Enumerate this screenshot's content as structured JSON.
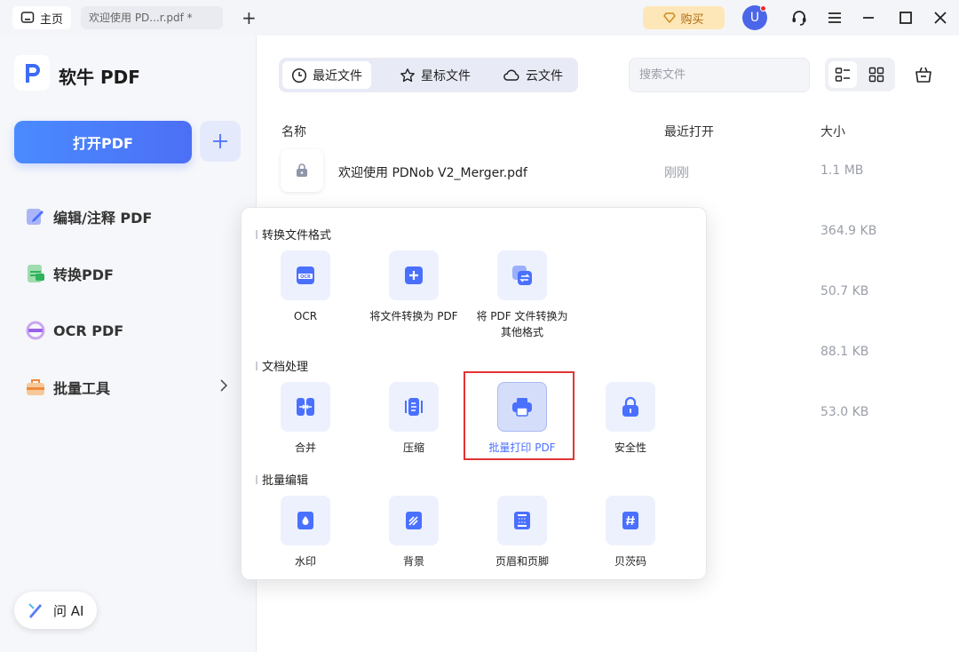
{
  "titlebar": {
    "home_tab": "主页",
    "doc_tab": "欢迎使用 PD...r.pdf *",
    "buy_label": "购买",
    "user_initial": "U"
  },
  "sidebar": {
    "logo_text": "软牛 PDF",
    "open_pdf": "打开PDF",
    "nav": [
      {
        "label": "编辑/注释 PDF"
      },
      {
        "label": "转换PDF"
      },
      {
        "label": "OCR PDF"
      },
      {
        "label": "批量工具"
      }
    ],
    "ai_label": "问 AI"
  },
  "main": {
    "tabs": [
      {
        "label": "最近文件"
      },
      {
        "label": "星标文件"
      },
      {
        "label": "云文件"
      }
    ],
    "search_placeholder": "搜索文件",
    "columns": {
      "name": "名称",
      "recent": "最近打开",
      "size": "大小"
    },
    "files": [
      {
        "name": "欢迎使用 PDNob V2_Merger.pdf",
        "opened": "刚刚",
        "size": "1.1 MB"
      },
      {
        "size": "364.9 KB"
      },
      {
        "size": "50.7 KB"
      },
      {
        "size": "88.1 KB"
      },
      {
        "size": "53.0 KB"
      }
    ]
  },
  "popup": {
    "sections": [
      {
        "title": "转换文件格式",
        "tools": [
          {
            "label": "OCR",
            "icon": "ocr-icon"
          },
          {
            "label": "将文件转换为 PDF",
            "icon": "file-plus-icon"
          },
          {
            "label": "将 PDF 文件转换为\n其他格式",
            "icon": "convert-icon"
          }
        ]
      },
      {
        "title": "文档处理",
        "tools": [
          {
            "label": "合并",
            "icon": "merge-icon"
          },
          {
            "label": "压缩",
            "icon": "compress-icon"
          },
          {
            "label": "批量打印 PDF",
            "icon": "printer-icon",
            "selected": true
          },
          {
            "label": "安全性",
            "icon": "lock-icon"
          }
        ]
      },
      {
        "title": "批量编辑",
        "tools": [
          {
            "label": "水印",
            "icon": "watermark-icon"
          },
          {
            "label": "背景",
            "icon": "background-icon"
          },
          {
            "label": "页眉和页脚",
            "icon": "header-footer-icon"
          },
          {
            "label": "贝茨码",
            "icon": "bates-icon"
          }
        ]
      }
    ]
  },
  "colors": {
    "accent": "#4a70ff",
    "highlight": "#e23434",
    "buy_bg": "#fde7b8"
  }
}
